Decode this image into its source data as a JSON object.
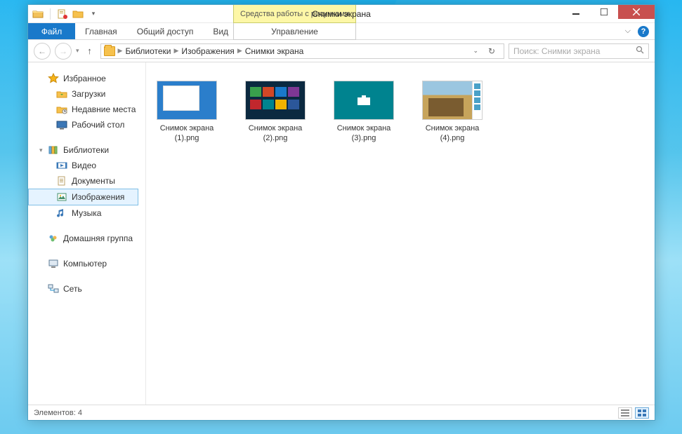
{
  "titlebar": {
    "title": "Снимки экрана",
    "tool_tab": "Средства работы с рисунками"
  },
  "ribbon": {
    "file": "Файл",
    "home": "Главная",
    "share": "Общий доступ",
    "view": "Вид",
    "manage": "Управление"
  },
  "address": {
    "crumb1": "Библиотеки",
    "crumb2": "Изображения",
    "crumb3": "Снимки экрана"
  },
  "search": {
    "placeholder": "Поиск: Снимки экрана"
  },
  "sidebar": {
    "favorites": "Избранное",
    "downloads": "Загрузки",
    "recent": "Недавние места",
    "desktop": "Рабочий стол",
    "libraries": "Библиотеки",
    "videos": "Видео",
    "documents": "Документы",
    "pictures": "Изображения",
    "music": "Музыка",
    "homegroup": "Домашняя группа",
    "computer": "Компьютер",
    "network": "Сеть"
  },
  "files": [
    {
      "name": "Снимок экрана (1).png"
    },
    {
      "name": "Снимок экрана (2).png"
    },
    {
      "name": "Снимок экрана (3).png"
    },
    {
      "name": "Снимок экрана (4).png"
    }
  ],
  "status": {
    "count_label": "Элементов: 4"
  }
}
